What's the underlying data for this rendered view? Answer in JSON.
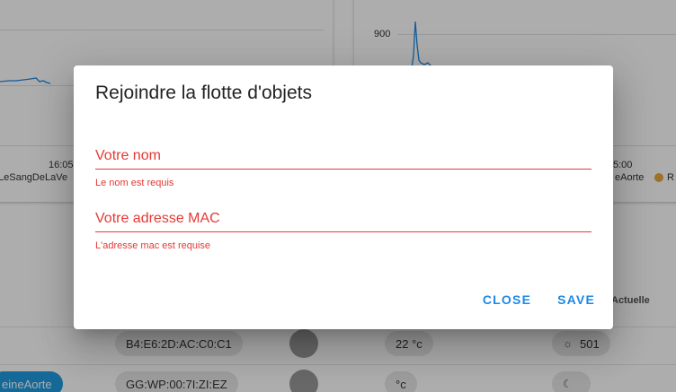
{
  "background": {
    "left_chart": {
      "x_tick": "16:05",
      "legend_label": "LeSangDeLaVe"
    },
    "right_chart": {
      "y_tick": "900",
      "x_tick": "5:00",
      "legend_label": "eAorte",
      "legend_extra": "R"
    },
    "table": {
      "header_actuelle": "Actuelle",
      "rows": [
        {
          "mac": "B4:E6:2D:AC:C0:C1",
          "temperature": "22 °c",
          "value": "501",
          "value_icon": "sun-icon"
        },
        {
          "name": "eineAorte",
          "mac": "GG:WP:00:7I:ZI:EZ",
          "temperature": "°c",
          "value": "",
          "value_icon": "moon-icon"
        }
      ]
    },
    "colors": {
      "chip_blue": "#1e9be0",
      "line_blue": "#1e88e5",
      "legend_orange": "#e5a93a"
    }
  },
  "dialog": {
    "title": "Rejoindre la flotte d'objets",
    "name_field": {
      "placeholder": "Votre nom",
      "value": "",
      "error": "Le nom est requis"
    },
    "mac_field": {
      "placeholder": "Votre adresse MAC",
      "value": "",
      "error": "L'adresse mac est requise"
    },
    "close_label": "CLOSE",
    "save_label": "SAVE",
    "colors": {
      "error": "#e53935",
      "action": "#1e88e5"
    }
  }
}
